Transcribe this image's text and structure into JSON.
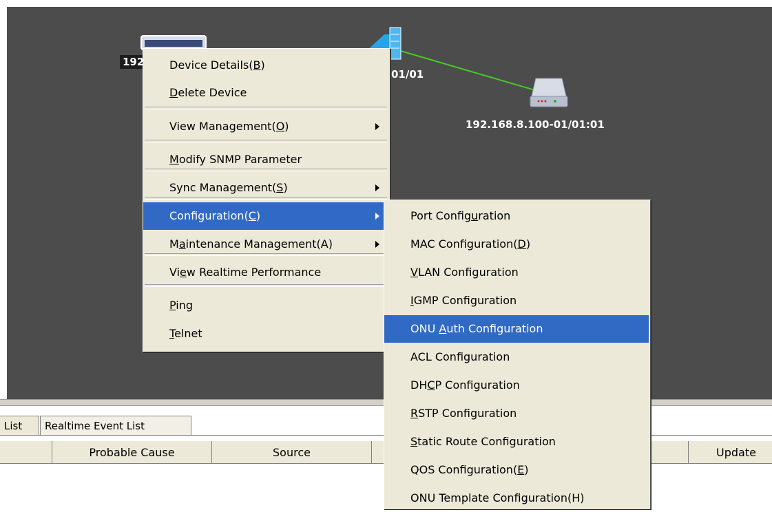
{
  "canvas": {
    "devices": [
      {
        "label": "192"
      },
      {
        "label": "01/01"
      },
      {
        "label": "192.168.8.100-01/01:01"
      }
    ],
    "link_color": "#44cc22"
  },
  "context_menu": {
    "items": [
      {
        "label": "Device Details(B)",
        "mnemonic": "B",
        "submenu": false
      },
      {
        "label": "Delete Device",
        "mnemonic": "D",
        "submenu": false
      },
      {
        "label": "View Management(O)",
        "mnemonic": "O",
        "submenu": true
      },
      {
        "label": "Modify SNMP Parameter",
        "mnemonic": "M",
        "submenu": false
      },
      {
        "label": "Sync Management(S)",
        "mnemonic": "S",
        "submenu": true
      },
      {
        "label": "Configuration(C)",
        "mnemonic": "C",
        "submenu": true,
        "selected": true
      },
      {
        "label": "Maintenance Management(A)",
        "mnemonic": "a",
        "submenu": true
      },
      {
        "label": "View Realtime Performance",
        "mnemonic": "e",
        "submenu": false
      },
      {
        "label": "Ping",
        "mnemonic": "P",
        "submenu": false
      },
      {
        "label": "Telnet",
        "mnemonic": "T",
        "submenu": false
      }
    ]
  },
  "config_submenu": {
    "items": [
      {
        "label": "Port Configuration",
        "mnemonic": "u"
      },
      {
        "label": "MAC Configuration(D)",
        "mnemonic": "D"
      },
      {
        "label": "VLAN Configuration",
        "mnemonic": "V"
      },
      {
        "label": "IGMP Configuration",
        "mnemonic": "I"
      },
      {
        "label": "ONU Auth Configuration",
        "mnemonic": "A",
        "selected": true
      },
      {
        "label": "ACL Configuration",
        "mnemonic": ""
      },
      {
        "label": "DHCP Configuration",
        "mnemonic": "C"
      },
      {
        "label": "RSTP Configuration",
        "mnemonic": "R"
      },
      {
        "label": "Static Route Configuration",
        "mnemonic": "S"
      },
      {
        "label": "QOS Configuration(E)",
        "mnemonic": "E"
      },
      {
        "label": "ONU Template Configuration(H)",
        "mnemonic": ""
      }
    ]
  },
  "bottom_panel": {
    "tabs": [
      {
        "label": "List"
      },
      {
        "label": "Realtime Event List"
      }
    ],
    "columns": [
      "",
      "Probable Cause",
      "Source",
      "",
      "",
      "Update"
    ]
  },
  "colors": {
    "canvas_bg": "#4c4c4c",
    "menu_bg": "#ece9d8",
    "selection": "#316ac5"
  }
}
